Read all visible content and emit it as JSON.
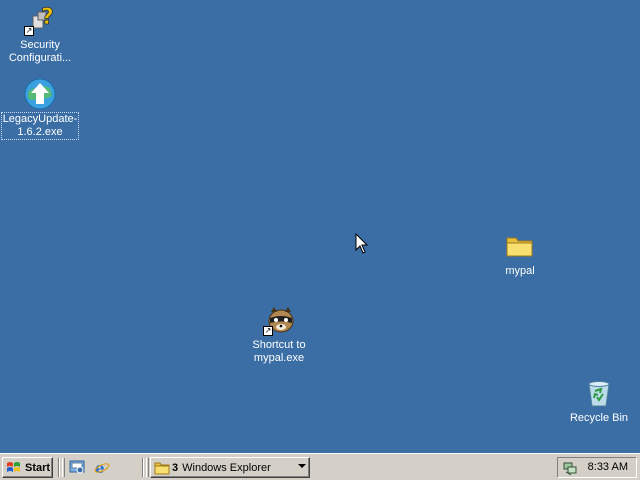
{
  "desktop": {
    "background_color": "#3a6ea5",
    "icons": [
      {
        "label_line1": "Security",
        "label_line2": "Configurati...",
        "icon": "security-config-icon"
      },
      {
        "label_line1": "LegacyUpdate-",
        "label_line2": "1.6.2.exe",
        "icon": "legacy-update-icon"
      },
      {
        "label_line1": "mypal",
        "label_line2": "",
        "icon": "folder-icon"
      },
      {
        "label_line1": "Shortcut to",
        "label_line2": "mypal.exe",
        "icon": "mypal-raccoon-icon"
      },
      {
        "label_line1": "Recycle Bin",
        "label_line2": "",
        "icon": "recycle-bin-icon"
      }
    ]
  },
  "taskbar": {
    "start_label": "Start",
    "quick_launch": [
      {
        "icon": "show-desktop-icon"
      },
      {
        "icon": "internet-explorer-icon"
      }
    ],
    "task_group": {
      "count": "3",
      "label": "Windows Explorer",
      "icon": "folder-icon"
    },
    "tray": {
      "icon": "network-icon",
      "clock": "8:33 AM"
    }
  }
}
